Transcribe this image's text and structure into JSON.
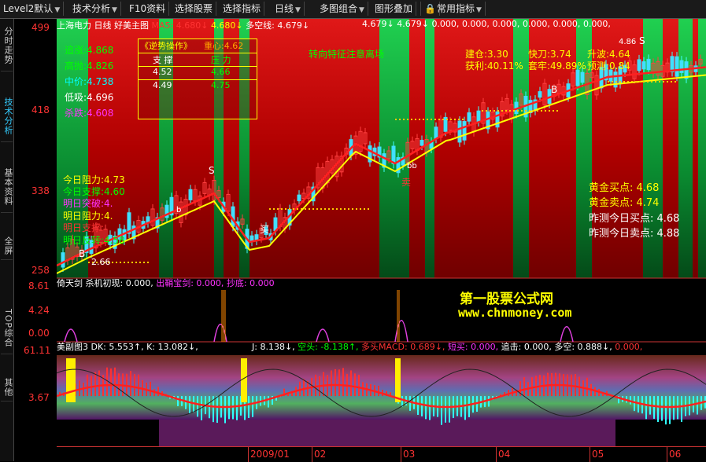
{
  "menubar": {
    "items": [
      {
        "label": "Level2默认",
        "dropdown": true
      },
      {
        "label": "技术分析",
        "dropdown": true
      },
      {
        "label": "F10资料",
        "dropdown": false
      },
      {
        "label": "选择股票",
        "dropdown": false
      },
      {
        "label": "选择指标",
        "dropdown": false
      },
      {
        "label": "日线",
        "dropdown": true
      },
      {
        "label": "多图组合",
        "dropdown": true
      },
      {
        "label": "图形叠加",
        "dropdown": false
      },
      {
        "label": "常用指标",
        "dropdown": true
      }
    ]
  },
  "sidebar": {
    "tabs": [
      {
        "label": "分时走势",
        "active": false
      },
      {
        "label": "技术分析",
        "active": true
      },
      {
        "label": "基本资料",
        "active": false
      },
      {
        "label": "全屏",
        "active": false
      },
      {
        "label": "TOP综合",
        "active": false
      },
      {
        "label": "其他",
        "active": false
      }
    ]
  },
  "main_panel": {
    "stock": "上海电力",
    "period": "日线",
    "indicator": "好美主图",
    "ma5": "MA5: 4.680↓",
    "ma_val2": "4.680↓",
    "duokong": "多空线: 4.679↓",
    "r1": "4.679↓",
    "r2": "4.679↓",
    "r3": "0.000,",
    "r4": "0.000,",
    "r5": "0.000,",
    "r6": "0.000,",
    "r7": "0.000,",
    "r8": "0.000,",
    "r9": "0.000,",
    "y_ticks": [
      "499",
      "418",
      "338",
      "258"
    ],
    "left_info": [
      {
        "label": "追涨:",
        "value": "4.868",
        "color": "#0f0"
      },
      {
        "label": "高抛:",
        "value": "4.826",
        "color": "#0f0"
      },
      {
        "label": "中价:",
        "value": "4.738",
        "color": "#0ff"
      },
      {
        "label": "低吸:",
        "value": "4.696",
        "color": "#fff"
      },
      {
        "label": "杀跌:",
        "value": "4.608",
        "color": "#f3f"
      }
    ],
    "table": {
      "title": "《逆势操作》",
      "zhongxin": "重心:4.62",
      "col1": "支  撑",
      "col2": "压  力",
      "rows": [
        [
          "4.52",
          "4.66"
        ],
        [
          "4.49",
          "4.75"
        ]
      ]
    },
    "trend_text": "转向特征注意离场",
    "left_lines": [
      {
        "text": "今日阻力:4.73",
        "color": "#ff0"
      },
      {
        "text": "今日支撑:4.60",
        "color": "#0f0"
      },
      {
        "text": "明日突破:4.",
        "color": "#f3f"
      },
      {
        "text": "明日阻力:4.",
        "color": "#ff0"
      },
      {
        "text": "明日支撑:",
        "color": "#f33"
      },
      {
        "text": "明日反转:4.58",
        "color": "#0f0"
      }
    ],
    "low_label": "2.66",
    "stats": {
      "jiancang": "建仓:3.30",
      "kuaidao": "快刀:3.74",
      "shengbo": "升波:4.64",
      "huoli": "获利:40.11%",
      "taolao": "套牢:49.89%",
      "yuce": "预测:0.84",
      "top_right": "4.86"
    },
    "right_info": [
      {
        "text": "黄金买点: 4.68",
        "color": "#ff0"
      },
      {
        "text": "黄金卖点: 4.74",
        "color": "#ff0"
      },
      {
        "text": "昨测今日买点: 4.68",
        "color": "#fff"
      },
      {
        "text": "昨测今日卖点: 4.88",
        "color": "#fff"
      }
    ],
    "chart_marks": [
      "B",
      "S",
      "b",
      "bb",
      "卖",
      "买",
      "B",
      "S"
    ]
  },
  "middle_panel": {
    "name": "倚天剑",
    "f1": "杀机初现: 0.000,",
    "f2": "出鞘宝剑: 0.000,",
    "f3": "抄底: 0.000",
    "y_ticks": [
      "8.61",
      "4.24",
      "0.00"
    ],
    "watermark1": "第一股票公式网",
    "watermark2": "www.chnmoney.com"
  },
  "bottom_panel": {
    "name": "美副图3",
    "dk": "DK: 5.553↑,",
    "k": "K: 13.082↓,",
    "j": "J: 8.138↓,",
    "kongtou": "空头: -8.138↑,",
    "duotou": "多头MACD: 0.689↓,",
    "duanmai": "短买: 0.000,",
    "zhuiji": "追击: 0.000,",
    "duokong": "多空: 0.888↓,",
    "last": "0.000,",
    "y_ticks": [
      "61.11",
      "3.67"
    ]
  },
  "xaxis": {
    "labels": [
      "2009/01",
      "02",
      "03",
      "04",
      "05",
      "06"
    ]
  }
}
